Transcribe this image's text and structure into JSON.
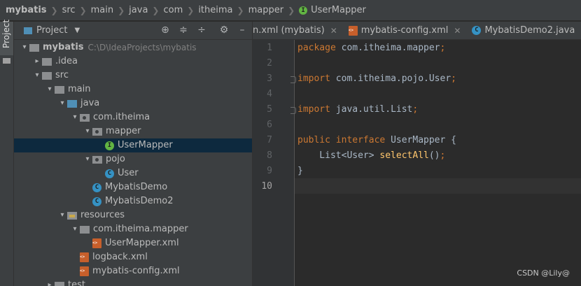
{
  "breadcrumb": [
    "mybatis",
    "src",
    "main",
    "java",
    "com",
    "itheima",
    "mapper",
    "UserMapper"
  ],
  "sidebar": {
    "vertical_tab": "Project"
  },
  "project_panel": {
    "title": "Project",
    "tree": [
      {
        "label": "mybatis",
        "path": "C:\\D\\IdeaProjects\\mybatis",
        "icon": "folder-icon",
        "arrow": "▾",
        "level": 0,
        "bold": true
      },
      {
        "label": ".idea",
        "icon": "folder-icon",
        "arrow": "▸",
        "level": 1
      },
      {
        "label": "src",
        "icon": "folder-icon",
        "arrow": "▾",
        "level": 1
      },
      {
        "label": "main",
        "icon": "folder-icon",
        "arrow": "▾",
        "level": 2
      },
      {
        "label": "java",
        "icon": "source-folder-icon",
        "arrow": "▾",
        "level": 3
      },
      {
        "label": "com.itheima",
        "icon": "package-icon",
        "arrow": "▾",
        "level": 4
      },
      {
        "label": "mapper",
        "icon": "package-icon",
        "arrow": "▾",
        "level": 5
      },
      {
        "label": "UserMapper",
        "icon": "interface-icon",
        "arrow": "",
        "level": 6,
        "selected": true
      },
      {
        "label": "pojo",
        "icon": "package-icon",
        "arrow": "▾",
        "level": 5
      },
      {
        "label": "User",
        "icon": "class-icon",
        "arrow": "",
        "level": 6
      },
      {
        "label": "MybatisDemo",
        "icon": "class-icon",
        "arrow": "",
        "level": 5
      },
      {
        "label": "MybatisDemo2",
        "icon": "class-icon",
        "arrow": "",
        "level": 5
      },
      {
        "label": "resources",
        "icon": "resources-folder-icon",
        "arrow": "▾",
        "level": 3
      },
      {
        "label": "com.itheima.mapper",
        "icon": "folder-icon",
        "arrow": "▾",
        "level": 4
      },
      {
        "label": "UserMapper.xml",
        "icon": "xml-file-icon",
        "arrow": "",
        "level": 5
      },
      {
        "label": "logback.xml",
        "icon": "xml-file-icon",
        "arrow": "",
        "level": 4
      },
      {
        "label": "mybatis-config.xml",
        "icon": "xml-file-icon",
        "arrow": "",
        "level": 4
      },
      {
        "label": "test",
        "icon": "folder-icon",
        "arrow": "▸",
        "level": 2
      }
    ]
  },
  "tabs": [
    {
      "label": "n.xml (mybatis)",
      "icon": ""
    },
    {
      "label": "mybatis-config.xml",
      "icon": "xml-file-icon"
    },
    {
      "label": "MybatisDemo2.java",
      "icon": "class-icon"
    },
    {
      "label": "U",
      "icon": "interface-icon"
    }
  ],
  "editor": {
    "line_numbers": [
      "1",
      "2",
      "3",
      "4",
      "5",
      "6",
      "7",
      "8",
      "9",
      "10"
    ],
    "current_line": "10",
    "lines": [
      [
        {
          "t": "package ",
          "c": "kw"
        },
        {
          "t": "com.itheima.mapper",
          "c": ""
        },
        {
          "t": ";",
          "c": "kw"
        }
      ],
      [],
      [
        {
          "t": "import ",
          "c": "kw"
        },
        {
          "t": "com.itheima.pojo.User",
          "c": ""
        },
        {
          "t": ";",
          "c": "kw"
        }
      ],
      [],
      [
        {
          "t": "import ",
          "c": "kw"
        },
        {
          "t": "java.util.List",
          "c": ""
        },
        {
          "t": ";",
          "c": "kw"
        }
      ],
      [],
      [
        {
          "t": "public interface ",
          "c": "kw"
        },
        {
          "t": "UserMapper {",
          "c": ""
        }
      ],
      [
        {
          "t": "    List<User> ",
          "c": ""
        },
        {
          "t": "selectAll",
          "c": "fn"
        },
        {
          "t": "()",
          "c": ""
        },
        {
          "t": ";",
          "c": "kw"
        }
      ],
      [
        {
          "t": "}",
          "c": ""
        }
      ],
      []
    ]
  },
  "watermark": "CSDN @Lily@"
}
